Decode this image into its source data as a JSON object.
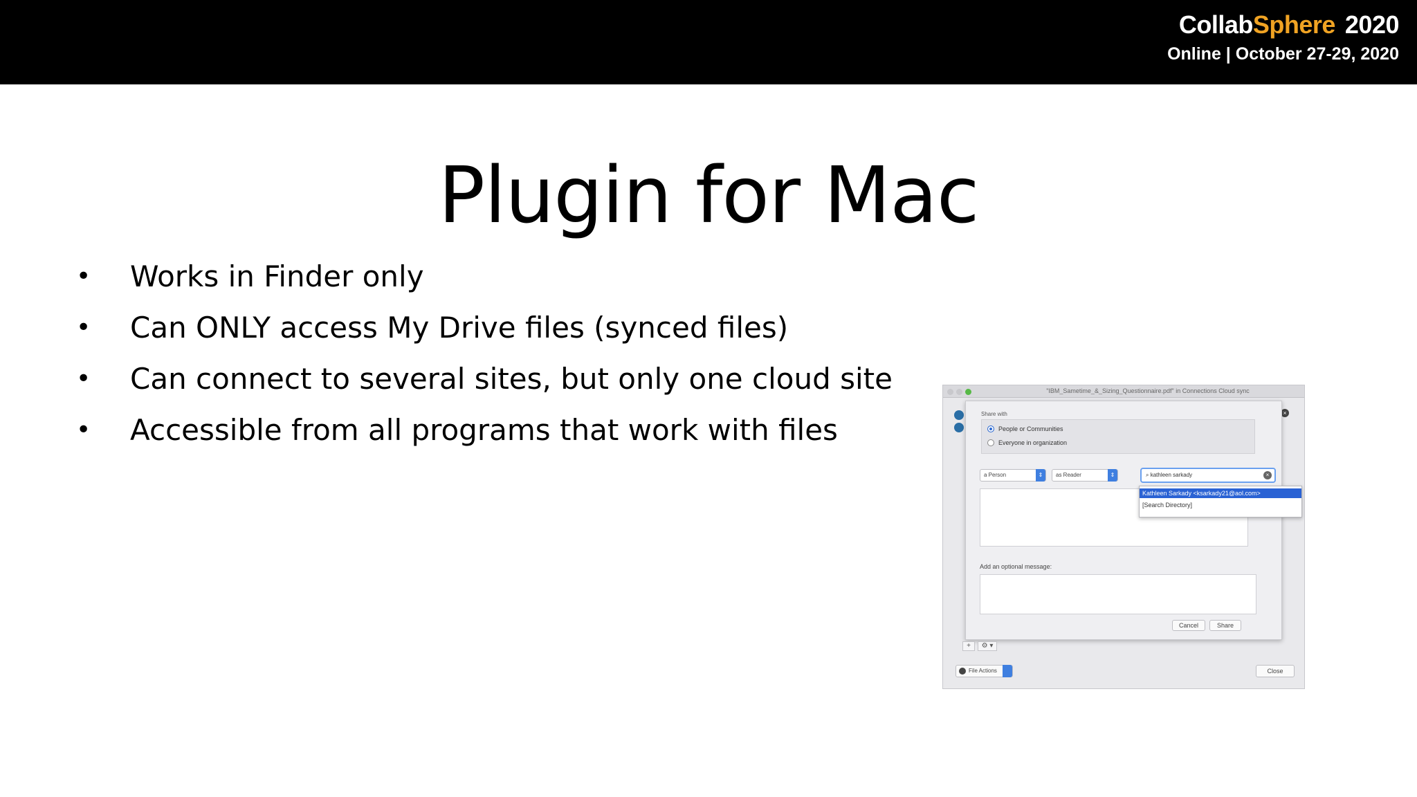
{
  "header": {
    "brand_collab": "Collab",
    "brand_sphere": "Sphere",
    "brand_year": "2020",
    "tagline": "Online | October 27-29, 2020",
    "brand_accent_color": "#f0a323",
    "background_color": "#000000"
  },
  "slide": {
    "title": "Plugin for Mac",
    "bullet_glyph": "•",
    "bullets": [
      "Works in Finder only",
      "Can ONLY access My Drive files (synced files)",
      "Can connect to several sites, but only one cloud site",
      "Accessible from all programs that work with files"
    ]
  },
  "dialog": {
    "window_title": "\"IBM_Sametime_&_Sizing_Questionnaire.pdf\" in Connections Cloud sync",
    "share_with_label": "Share with",
    "radio_options": [
      "People or Communities",
      "Everyone in organization"
    ],
    "person_select": "a Person",
    "role_select": "as Reader",
    "search_value": "kathleen sarkady",
    "dropdown_items": [
      "Kathleen Sarkady <ksarkady21@aol.com>",
      "[Search Directory]"
    ],
    "message_label": "Add an optional message:",
    "cancel_label": "Cancel",
    "share_label": "Share",
    "plus_label": "+",
    "gear_menu_label": "⚙ ▾",
    "file_actions_label": "File Actions",
    "close_label": "Close"
  }
}
